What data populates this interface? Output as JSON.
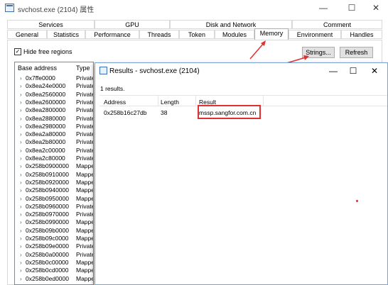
{
  "window": {
    "title": "svchost.exe (2104) 属性",
    "minimize": "—",
    "maximize": "☐",
    "close": "✕"
  },
  "tabs_row1": [
    "Services",
    "GPU",
    "Disk and Network",
    "Comment"
  ],
  "tabs_row2": [
    "General",
    "Statistics",
    "Performance",
    "Threads",
    "Token",
    "Modules",
    "Memory",
    "Environment",
    "Handles"
  ],
  "active_tab": "Memory",
  "options": {
    "hide_free_label": "Hide free regions",
    "hide_free_checked": true,
    "strings_button": "Strings...",
    "refresh_button": "Refresh"
  },
  "memory_list": {
    "columns": [
      "Base address",
      "Type"
    ],
    "rows": [
      {
        "address": "0x7ffe0000",
        "type": "Private"
      },
      {
        "address": "0x8ea24e0000",
        "type": "Private"
      },
      {
        "address": "0x8ea2560000",
        "type": "Private"
      },
      {
        "address": "0x8ea2600000",
        "type": "Private"
      },
      {
        "address": "0x8ea2800000",
        "type": "Private"
      },
      {
        "address": "0x8ea2880000",
        "type": "Private"
      },
      {
        "address": "0x8ea2980000",
        "type": "Private"
      },
      {
        "address": "0x8ea2a80000",
        "type": "Private"
      },
      {
        "address": "0x8ea2b80000",
        "type": "Private"
      },
      {
        "address": "0x8ea2c00000",
        "type": "Private"
      },
      {
        "address": "0x8ea2c80000",
        "type": "Private"
      },
      {
        "address": "0x258b0900000",
        "type": "Mapped"
      },
      {
        "address": "0x258b0910000",
        "type": "Mapped"
      },
      {
        "address": "0x258b0920000",
        "type": "Mapped"
      },
      {
        "address": "0x258b0940000",
        "type": "Mapped"
      },
      {
        "address": "0x258b0950000",
        "type": "Mapped"
      },
      {
        "address": "0x258b0960000",
        "type": "Private"
      },
      {
        "address": "0x258b0970000",
        "type": "Private"
      },
      {
        "address": "0x258b0990000",
        "type": "Mapped"
      },
      {
        "address": "0x258b09b0000",
        "type": "Mapped"
      },
      {
        "address": "0x258b09c0000",
        "type": "Mapped"
      },
      {
        "address": "0x258b09e0000",
        "type": "Private"
      },
      {
        "address": "0x258b0a00000",
        "type": "Private"
      },
      {
        "address": "0x258b0c00000",
        "type": "Mapped"
      },
      {
        "address": "0x258b0cd0000",
        "type": "Mapped"
      },
      {
        "address": "0x258b0ed0000",
        "type": "Mapped"
      }
    ]
  },
  "results_dialog": {
    "title": "Results - svchost.exe (2104)",
    "minimize": "—",
    "maximize": "☐",
    "close": "✕",
    "count_text": "1 results.",
    "columns": [
      "Address",
      "Length",
      "Result"
    ],
    "rows": [
      {
        "address": "0x258b16c27db",
        "length": "38",
        "result": "mssp.sangfor.com.cn"
      }
    ]
  },
  "colors": {
    "annotation_red": "#e03030",
    "dialog_border": "#7aa1d4"
  }
}
